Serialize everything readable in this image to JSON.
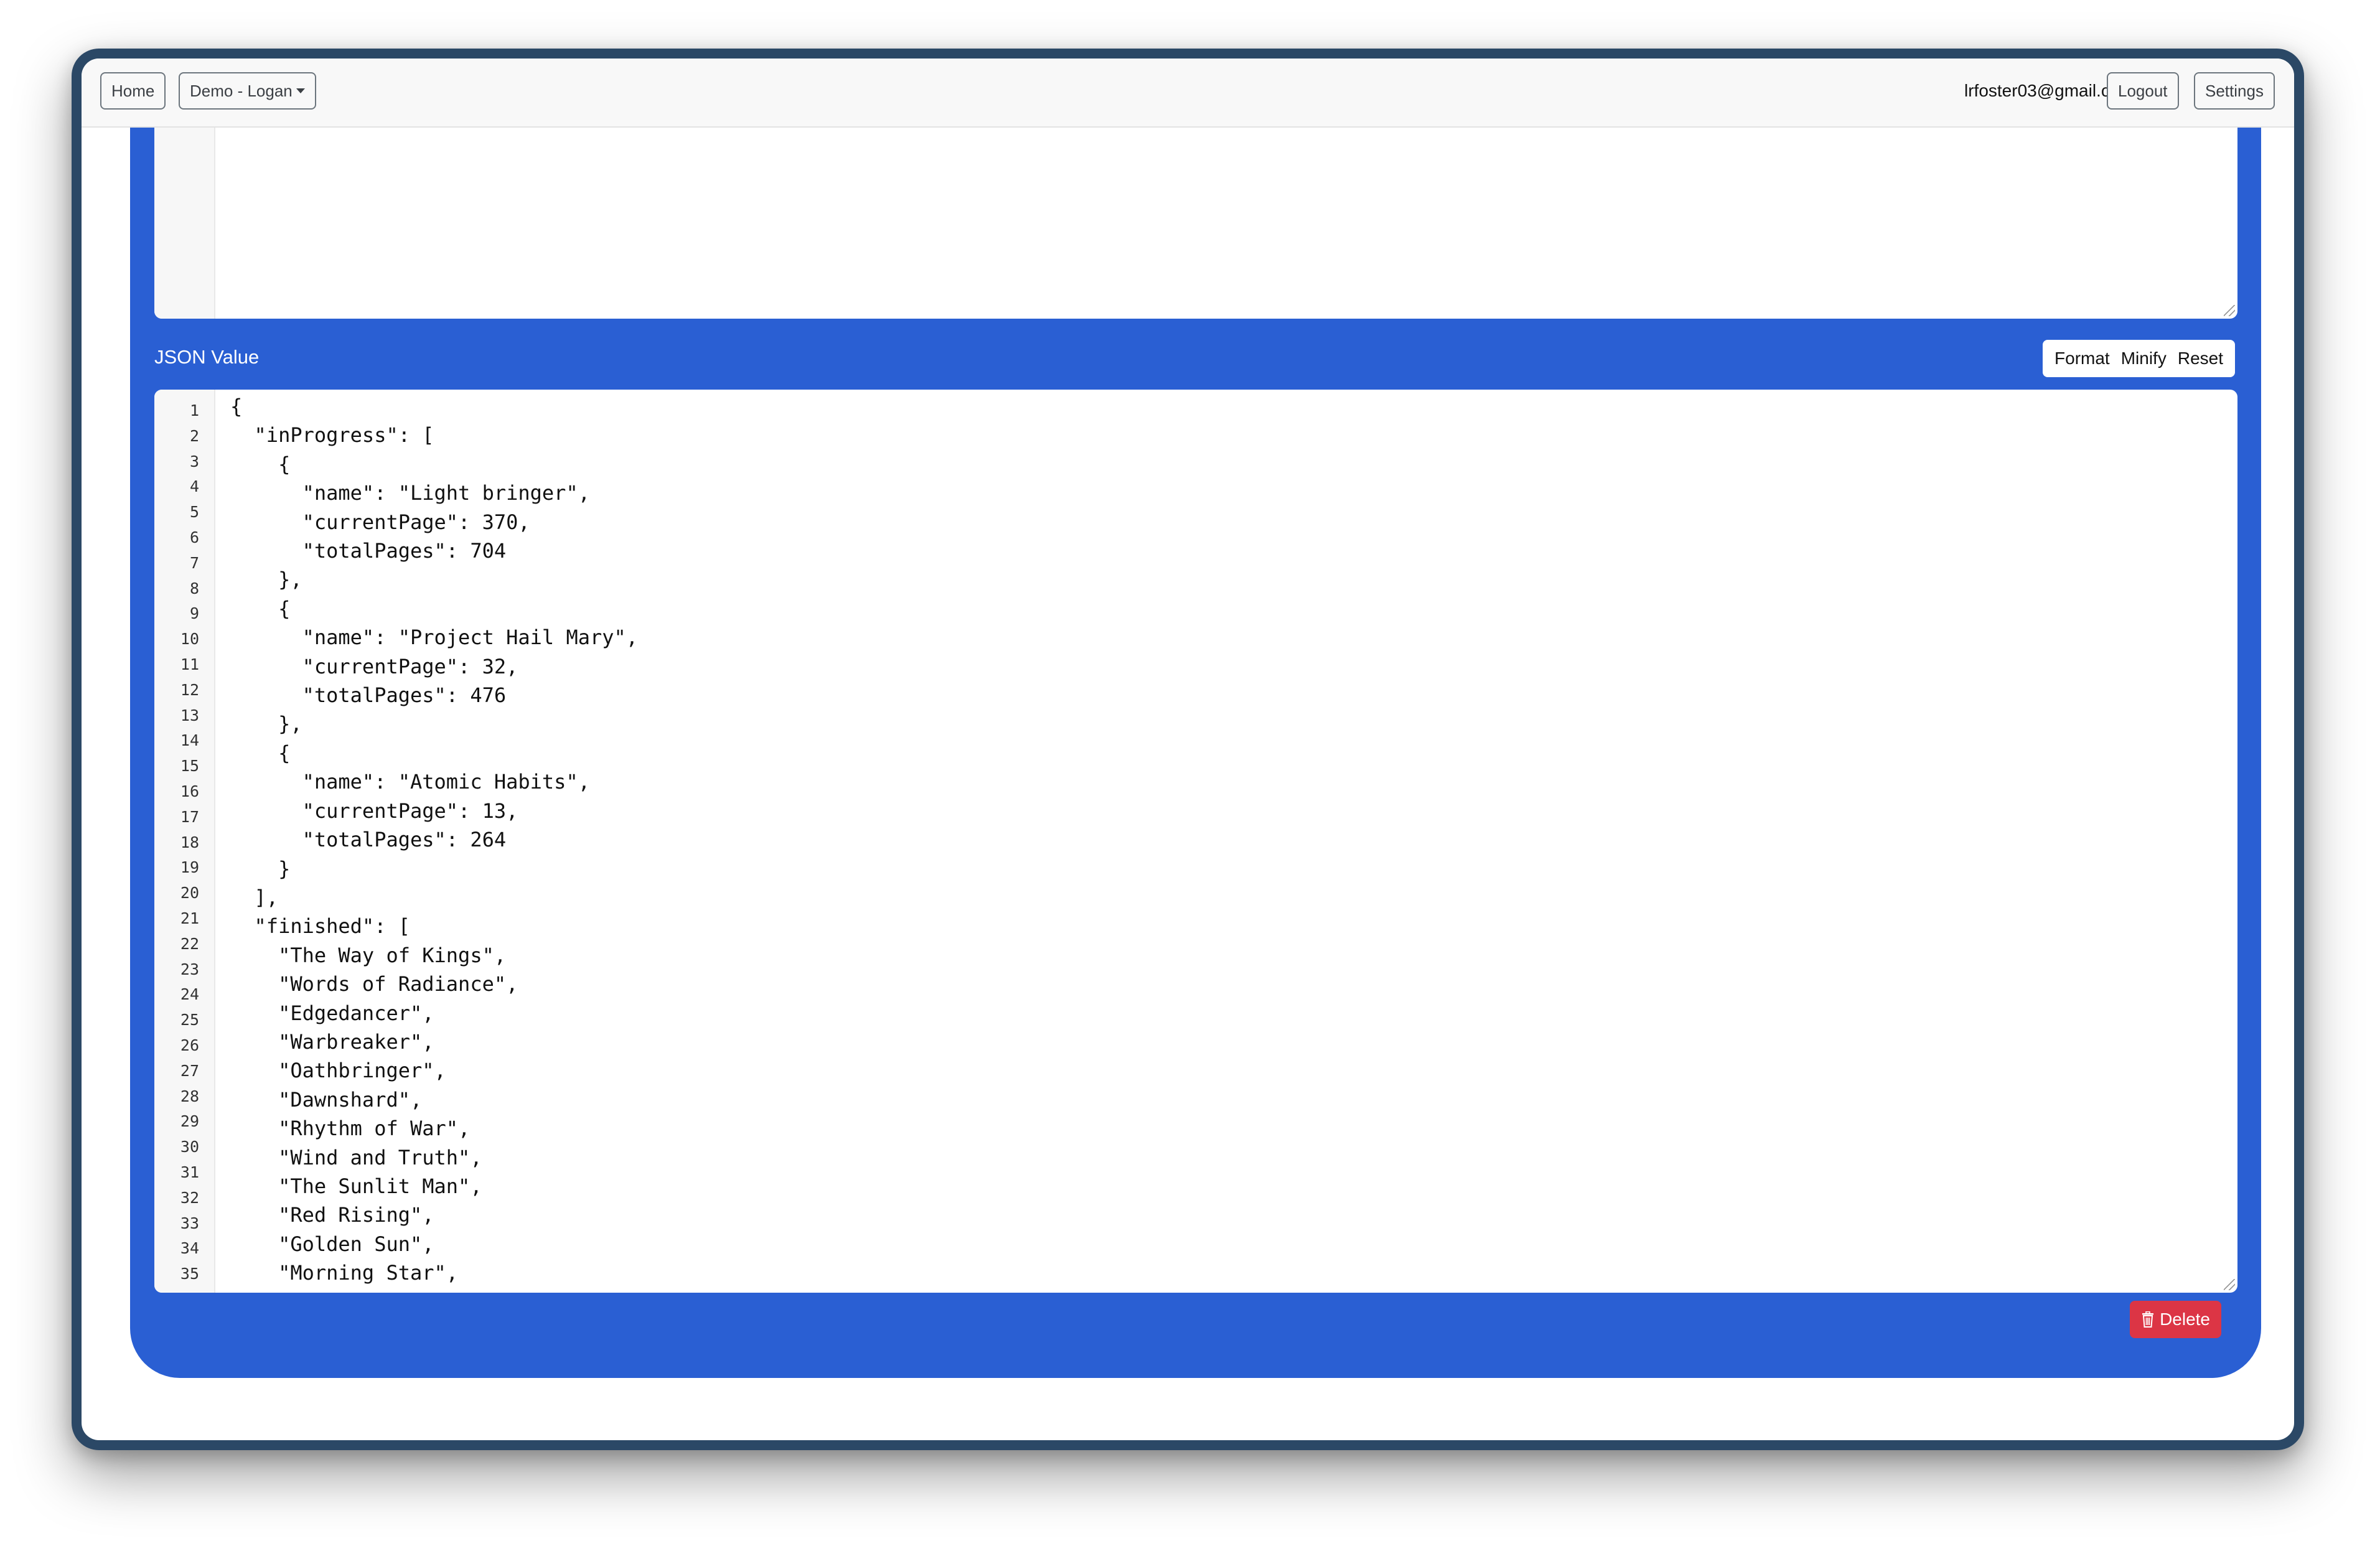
{
  "navbar": {
    "home_label": "Home",
    "demo_label": "Demo - Logan",
    "user_email": "lrfoster03@gmail.com",
    "logout_label": "Logout",
    "settings_label": "Settings"
  },
  "json_section": {
    "label": "JSON Value",
    "format_label": "Format",
    "minify_label": "Minify",
    "reset_label": "Reset",
    "line_numbers": "1\n2\n3\n4\n5\n6\n7\n8\n9\n10\n11\n12\n13\n14\n15\n16\n17\n18\n19\n20\n21\n22\n23\n24\n25\n26\n27\n28\n29\n30\n31\n32\n33\n34\n35",
    "code": "{\n  \"inProgress\": [\n    {\n      \"name\": \"Light bringer\",\n      \"currentPage\": 370,\n      \"totalPages\": 704\n    },\n    {\n      \"name\": \"Project Hail Mary\",\n      \"currentPage\": 32,\n      \"totalPages\": 476\n    },\n    {\n      \"name\": \"Atomic Habits\",\n      \"currentPage\": 13,\n      \"totalPages\": 264\n    }\n  ],\n  \"finished\": [\n    \"The Way of Kings\",\n    \"Words of Radiance\",\n    \"Edgedancer\",\n    \"Warbreaker\",\n    \"Oathbringer\",\n    \"Dawnshard\",\n    \"Rhythm of War\",\n    \"Wind and Truth\",\n    \"The Sunlit Man\",\n    \"Red Rising\",\n    \"Golden Sun\",\n    \"Morning Star\","
  },
  "actions": {
    "delete_label": "Delete",
    "delete_icon": "trash-icon"
  },
  "colors": {
    "panel": "#2a5fd3",
    "delete": "#dc3545",
    "frame": "#2b4866"
  }
}
